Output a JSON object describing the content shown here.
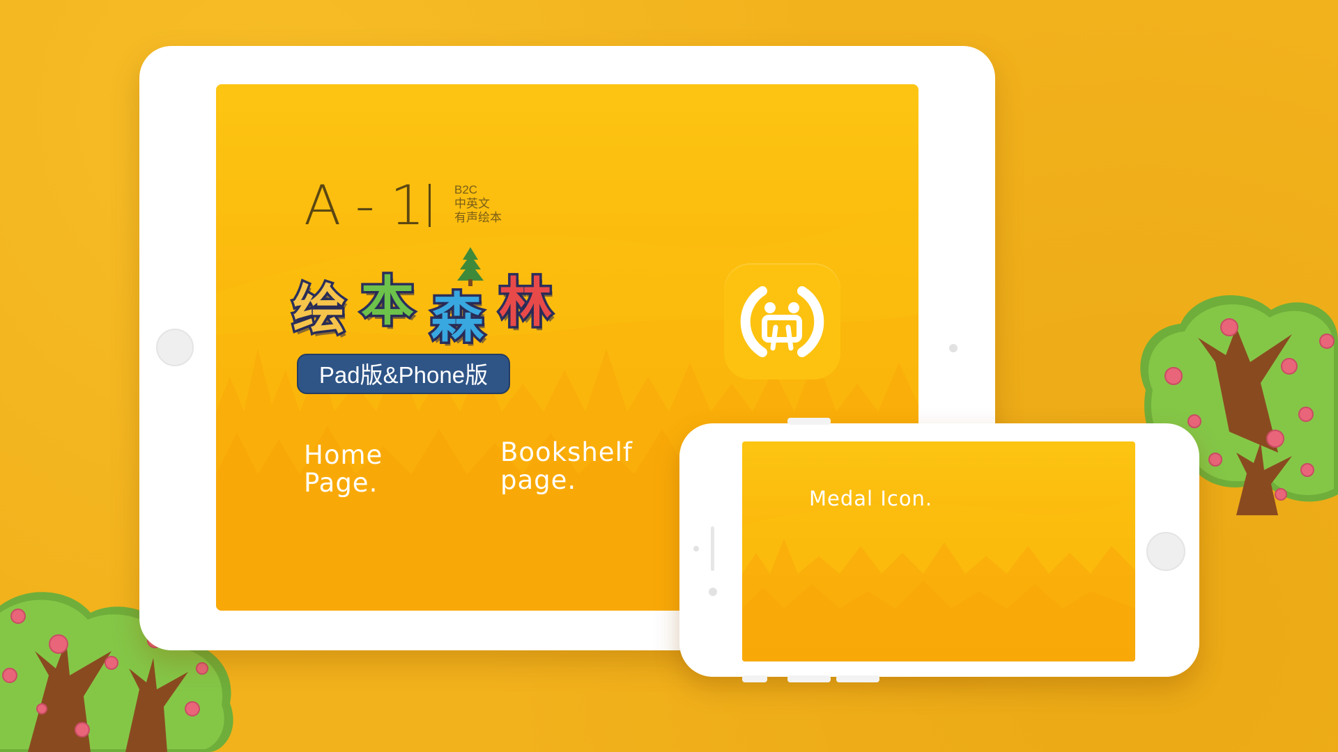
{
  "brand": {
    "code": "A-1",
    "tags": [
      "B2C",
      "中英文",
      "有声绘本"
    ]
  },
  "logo": {
    "chars": [
      "绘",
      "本",
      "森",
      "林"
    ],
    "colors": [
      "#f6c44a",
      "#6cc24a",
      "#39a8e0",
      "#e84a4a"
    ],
    "badge": "Pad版&Phone版"
  },
  "app_icon": {
    "name": "audio-book-app-icon"
  },
  "ipad_nav": {
    "home": [
      "Home",
      "Page."
    ],
    "bookshelf": [
      "Bookshelf",
      "page."
    ]
  },
  "iphone": {
    "medal": "Medal Icon."
  },
  "colors": {
    "background": "#f2b21c",
    "screen_top": "#fdc512",
    "screen_bottom": "#f9a808",
    "badge": "#2f5587",
    "tree_foliage": "#7cc142",
    "tree_trunk": "#8a4a20",
    "tree_apple": "#e8657a"
  }
}
